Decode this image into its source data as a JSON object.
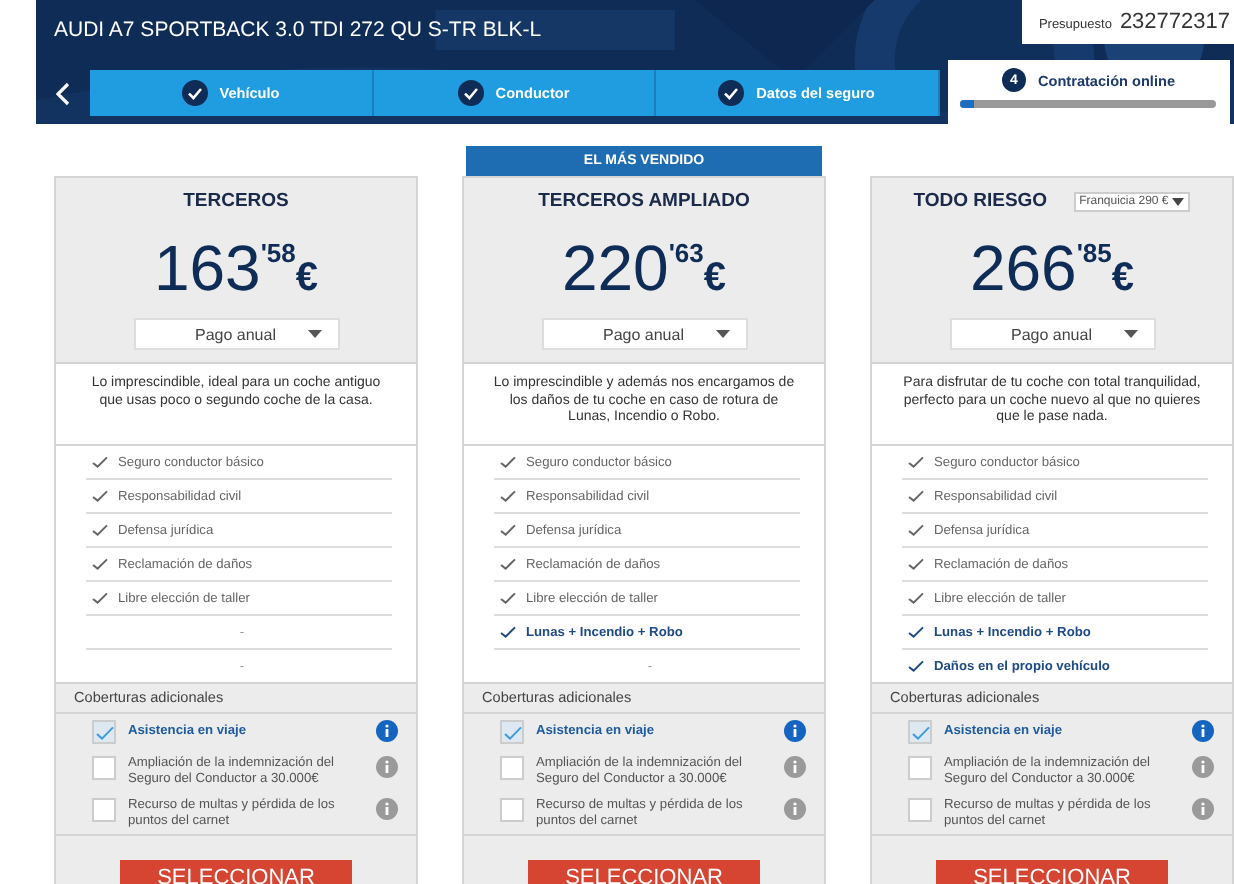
{
  "header": {
    "title": "AUDI A7 SPORTBACK 3.0 TDI 272 QU S-TR BLK-L",
    "budget_label": "Presupuesto",
    "budget_number": "232772317"
  },
  "steps": [
    {
      "label": "Vehículo",
      "done": true,
      "selected": false
    },
    {
      "label": "Conductor",
      "done": true,
      "selected": false
    },
    {
      "label": "Datos del seguro",
      "done": true,
      "selected": false
    },
    {
      "label": "Contratación online",
      "done": false,
      "selected": true,
      "number": "4",
      "level": 0.05
    }
  ],
  "plans": [
    {
      "title": "TERCEROS",
      "price_int": "163",
      "price_dec": "'58",
      "currency": "€",
      "payment": "Pago anual",
      "description": "Lo imprescindible, ideal para un coche antiguo que usas poco o segundo coche de la casa.",
      "features": [
        {
          "kind": "basic",
          "text": "Seguro conductor básico"
        },
        {
          "kind": "basic",
          "text": "Responsabilidad civil"
        },
        {
          "kind": "basic",
          "text": "Defensa jurídica"
        },
        {
          "kind": "basic",
          "text": "Reclamación de daños"
        },
        {
          "kind": "basic",
          "text": "Libre elección de taller"
        },
        {
          "kind": "none",
          "text": "-"
        },
        {
          "kind": "none",
          "text": "-"
        }
      ],
      "extras_title": "Coberturas adicionales",
      "extras": [
        {
          "text": "Asistencia en viaje",
          "checked": true
        },
        {
          "text": "Ampliación de la indemnización del Seguro del Conductor a 30.000€",
          "checked": false
        },
        {
          "text": "Recurso de multas y pérdida de los puntos del carnet",
          "checked": false
        }
      ],
      "button": "SELECCIONAR"
    },
    {
      "badge": "EL MÁS VENDIDO",
      "title": "TERCEROS AMPLIADO",
      "price_int": "220",
      "price_dec": "'63",
      "currency": "€",
      "payment": "Pago anual",
      "description": "Lo imprescindible y además nos encargamos de los daños de tu coche en caso de rotura de Lunas, Incendio o Robo.",
      "features": [
        {
          "kind": "basic",
          "text": "Seguro conductor básico"
        },
        {
          "kind": "basic",
          "text": "Responsabilidad civil"
        },
        {
          "kind": "basic",
          "text": "Defensa jurídica"
        },
        {
          "kind": "basic",
          "text": "Reclamación de daños"
        },
        {
          "kind": "basic",
          "text": "Libre elección de taller"
        },
        {
          "kind": "extra",
          "text": "Lunas + Incendio + Robo"
        },
        {
          "kind": "none",
          "text": "-"
        }
      ],
      "extras_title": "Coberturas adicionales",
      "extras": [
        {
          "text": "Asistencia en viaje",
          "checked": true
        },
        {
          "text": "Ampliación de la indemnización del Seguro del Conductor a 30.000€",
          "checked": false
        },
        {
          "text": "Recurso de multas y pérdida de los puntos del carnet",
          "checked": false
        }
      ],
      "button": "SELECCIONAR"
    },
    {
      "title": "TODO RIESGO",
      "franchise": "Franquicia 290 €",
      "price_int": "266",
      "price_dec": "'85",
      "currency": "€",
      "payment": "Pago anual",
      "description": "Para disfrutar de tu coche con total tranquilidad, perfecto para un coche nuevo al que no quieres que le pase nada.",
      "features": [
        {
          "kind": "basic",
          "text": "Seguro conductor básico"
        },
        {
          "kind": "basic",
          "text": "Responsabilidad civil"
        },
        {
          "kind": "basic",
          "text": "Defensa jurídica"
        },
        {
          "kind": "basic",
          "text": "Reclamación de daños"
        },
        {
          "kind": "basic",
          "text": "Libre elección de taller"
        },
        {
          "kind": "extra",
          "text": "Lunas + Incendio + Robo"
        },
        {
          "kind": "extra",
          "text": "Daños en el propio vehículo"
        }
      ],
      "extras_title": "Coberturas adicionales",
      "extras": [
        {
          "text": "Asistencia en viaje",
          "checked": true
        },
        {
          "text": "Ampliación de la indemnización del Seguro del Conductor a 30.000€",
          "checked": false
        },
        {
          "text": "Recurso de multas y pérdida de los puntos del carnet",
          "checked": false
        }
      ],
      "button": "SELECCIONAR"
    }
  ]
}
